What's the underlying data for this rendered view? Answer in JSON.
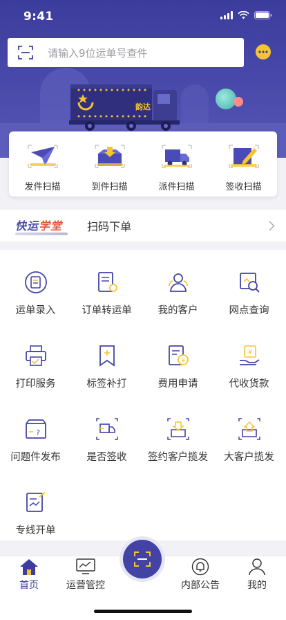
{
  "status": {
    "time": "9:41"
  },
  "search": {
    "placeholder": "请输入9位运单号查件"
  },
  "hero": {
    "truck_label": "韵达"
  },
  "scan_actions": [
    {
      "label": "发件扫描",
      "icon": "send-plane-icon"
    },
    {
      "label": "到件扫描",
      "icon": "arrival-box-icon"
    },
    {
      "label": "派件扫描",
      "icon": "delivery-truck-icon"
    },
    {
      "label": "签收扫描",
      "icon": "signature-pen-icon"
    }
  ],
  "banner": {
    "brand_main": "快运",
    "brand_accent": "学堂",
    "title": "扫码下单"
  },
  "grid": [
    {
      "label": "运单录入",
      "icon": "waybill-entry-icon"
    },
    {
      "label": "订单转运单",
      "icon": "order-convert-icon"
    },
    {
      "label": "我的客户",
      "icon": "customers-icon"
    },
    {
      "label": "网点查询",
      "icon": "outlet-search-icon"
    },
    {
      "label": "打印服务",
      "icon": "printer-icon"
    },
    {
      "label": "标签补打",
      "icon": "bookmark-label-icon"
    },
    {
      "label": "费用申请",
      "icon": "fee-document-icon"
    },
    {
      "label": "代收货款",
      "icon": "cod-payment-icon"
    },
    {
      "label": "问题件发布",
      "icon": "problem-package-icon"
    },
    {
      "label": "是否签收",
      "icon": "sign-check-truck-icon"
    },
    {
      "label": "签约客户揽发",
      "icon": "contract-pickup-icon"
    },
    {
      "label": "大客户揽发",
      "icon": "vip-pickup-icon"
    },
    {
      "label": "专线开单",
      "icon": "dedicated-line-icon"
    }
  ],
  "tabs": [
    {
      "label": "首页",
      "icon": "home-icon",
      "active": true
    },
    {
      "label": "运营管控",
      "icon": "monitor-chart-icon",
      "active": false
    },
    {
      "label": "内部公告",
      "icon": "bell-icon",
      "active": false
    },
    {
      "label": "我的",
      "icon": "person-icon",
      "active": false
    }
  ],
  "colors": {
    "primary": "#4343a6",
    "accent": "#f7c431",
    "header_bg": "#3c3c9c"
  }
}
